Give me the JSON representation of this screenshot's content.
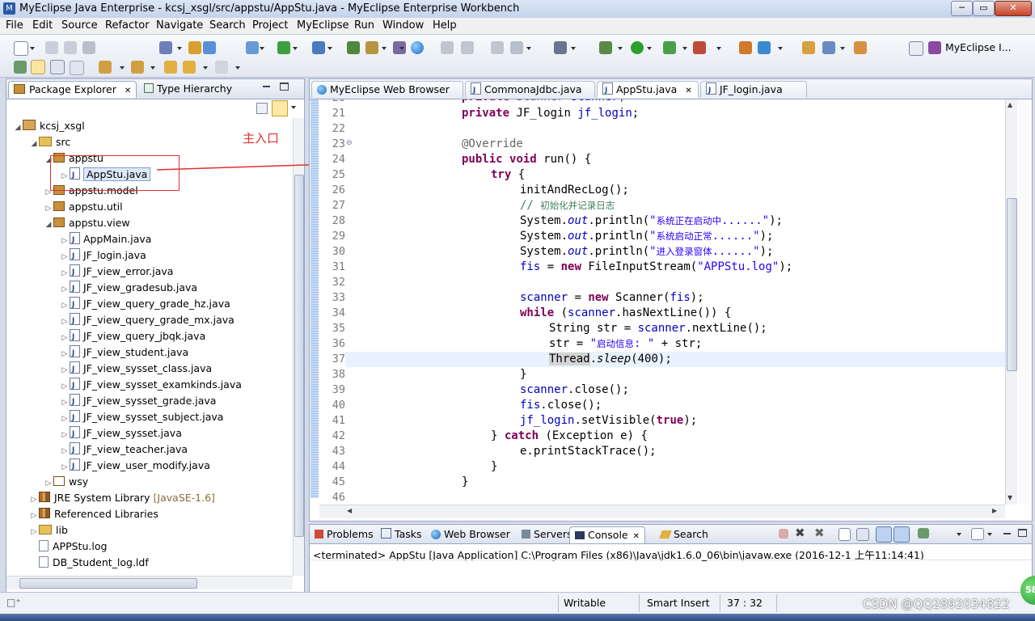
{
  "window": {
    "title": "MyEclipse Java Enterprise - kcsj_xsgl/src/appstu/AppStu.java - MyEclipse Enterprise Workbench",
    "minimize": "─",
    "maximize": "▭",
    "close": "✕"
  },
  "menu": [
    "File",
    "Edit",
    "Source",
    "Refactor",
    "Navigate",
    "Search",
    "Project",
    "MyEclipse",
    "Run",
    "Window",
    "Help"
  ],
  "perspective": {
    "label": "MyEclipse I..."
  },
  "package_explorer": {
    "tabs": [
      {
        "label": "Package Explorer",
        "close": "✕"
      },
      {
        "label": "Type Hierarchy"
      }
    ],
    "tree": [
      {
        "label": "kcsj_xsgl",
        "icon": "project",
        "depth": 0,
        "toggle": "expanded"
      },
      {
        "label": "src",
        "icon": "folder",
        "depth": 1,
        "toggle": "expanded"
      },
      {
        "label": "appstu",
        "icon": "package",
        "depth": 2,
        "toggle": "expanded"
      },
      {
        "label": "AppStu.java",
        "icon": "java",
        "depth": 3,
        "toggle": "collapsed",
        "selected": true
      },
      {
        "label": "appstu.model",
        "icon": "package",
        "depth": 2,
        "toggle": "collapsed"
      },
      {
        "label": "appstu.util",
        "icon": "package",
        "depth": 2,
        "toggle": "collapsed"
      },
      {
        "label": "appstu.view",
        "icon": "package",
        "depth": 2,
        "toggle": "expanded"
      },
      {
        "label": "AppMain.java",
        "icon": "java",
        "depth": 3,
        "toggle": "collapsed"
      },
      {
        "label": "JF_login.java",
        "icon": "java",
        "depth": 3,
        "toggle": "collapsed"
      },
      {
        "label": "JF_view_error.java",
        "icon": "java",
        "depth": 3,
        "toggle": "collapsed"
      },
      {
        "label": "JF_view_gradesub.java",
        "icon": "java",
        "depth": 3,
        "toggle": "collapsed"
      },
      {
        "label": "JF_view_query_grade_hz.java",
        "icon": "java",
        "depth": 3,
        "toggle": "collapsed"
      },
      {
        "label": "JF_view_query_grade_mx.java",
        "icon": "java",
        "depth": 3,
        "toggle": "collapsed"
      },
      {
        "label": "JF_view_query_jbqk.java",
        "icon": "java",
        "depth": 3,
        "toggle": "collapsed"
      },
      {
        "label": "JF_view_student.java",
        "icon": "java",
        "depth": 3,
        "toggle": "collapsed"
      },
      {
        "label": "JF_view_sysset_class.java",
        "icon": "java",
        "depth": 3,
        "toggle": "collapsed"
      },
      {
        "label": "JF_view_sysset_examkinds.java",
        "icon": "java",
        "depth": 3,
        "toggle": "collapsed"
      },
      {
        "label": "JF_view_sysset_grade.java",
        "icon": "java",
        "depth": 3,
        "toggle": "collapsed"
      },
      {
        "label": "JF_view_sysset_subject.java",
        "icon": "java",
        "depth": 3,
        "toggle": "collapsed"
      },
      {
        "label": "JF_view_sysset.java",
        "icon": "java",
        "depth": 3,
        "toggle": "collapsed"
      },
      {
        "label": "JF_view_teacher.java",
        "icon": "java",
        "depth": 3,
        "toggle": "collapsed"
      },
      {
        "label": "JF_view_user_modify.java",
        "icon": "java",
        "depth": 3,
        "toggle": "collapsed"
      },
      {
        "label": "wsy",
        "icon": "package-empty",
        "depth": 2,
        "toggle": "collapsed"
      },
      {
        "label": "JRE System Library",
        "suffix": "[JavaSE-1.6]",
        "icon": "library",
        "depth": 1,
        "toggle": "collapsed"
      },
      {
        "label": "Referenced Libraries",
        "icon": "library",
        "depth": 1,
        "toggle": "collapsed"
      },
      {
        "label": "lib",
        "icon": "folder",
        "depth": 1,
        "toggle": "collapsed"
      },
      {
        "label": "APPStu.log",
        "icon": "file",
        "depth": 1,
        "toggle": "none"
      },
      {
        "label": "DB_Student_log.ldf",
        "icon": "file",
        "depth": 1,
        "toggle": "none"
      }
    ]
  },
  "annotation": {
    "label": "主入口",
    "color": "#e03030"
  },
  "editor": {
    "tabs": [
      {
        "label": "MyEclipse Web Browser",
        "icon": "globe"
      },
      {
        "label": "CommonaJdbc.java",
        "icon": "java"
      },
      {
        "label": "AppStu.java",
        "icon": "java",
        "active": true,
        "close": "✕"
      },
      {
        "label": "JF_login.java",
        "icon": "java"
      }
    ],
    "partial_top_line": "20",
    "cursor_line": 37,
    "lines": [
      {
        "n": "21",
        "indent": 2,
        "segs": [
          [
            "kw",
            "private"
          ],
          [
            "t",
            " JF_login "
          ],
          [
            "fld",
            "jf_login"
          ],
          [
            "t",
            ";"
          ]
        ]
      },
      {
        "n": "22",
        "indent": 0,
        "segs": []
      },
      {
        "n": "23",
        "indent": 2,
        "fold": true,
        "segs": [
          [
            "ann",
            "@Override"
          ]
        ]
      },
      {
        "n": "24",
        "indent": 2,
        "segs": [
          [
            "kw",
            "public"
          ],
          [
            "t",
            " "
          ],
          [
            "kw",
            "void"
          ],
          [
            "t",
            " run() {"
          ]
        ]
      },
      {
        "n": "25",
        "indent": 3,
        "segs": [
          [
            "kw",
            "try"
          ],
          [
            "t",
            " {"
          ]
        ]
      },
      {
        "n": "26",
        "indent": 4,
        "segs": [
          [
            "t",
            "initAndRecLog();"
          ]
        ]
      },
      {
        "n": "27",
        "indent": 4,
        "segs": [
          [
            "cm",
            "// "
          ],
          [
            "cmcn",
            "初始化并记录日志"
          ]
        ]
      },
      {
        "n": "28",
        "indent": 4,
        "segs": [
          [
            "t",
            "System."
          ],
          [
            "fldi",
            "out"
          ],
          [
            "t",
            ".println("
          ],
          [
            "str",
            "\""
          ],
          [
            "strcn",
            "系统正在启动中"
          ],
          [
            "str",
            "......\""
          ],
          [
            "t",
            ");"
          ]
        ]
      },
      {
        "n": "29",
        "indent": 4,
        "segs": [
          [
            "t",
            "System."
          ],
          [
            "fldi",
            "out"
          ],
          [
            "t",
            ".println("
          ],
          [
            "str",
            "\""
          ],
          [
            "strcn",
            "系统启动正常"
          ],
          [
            "str",
            "......\""
          ],
          [
            "t",
            ");"
          ]
        ]
      },
      {
        "n": "30",
        "indent": 4,
        "segs": [
          [
            "t",
            "System."
          ],
          [
            "fldi",
            "out"
          ],
          [
            "t",
            ".println("
          ],
          [
            "str",
            "\""
          ],
          [
            "strcn",
            "进入登录窗体"
          ],
          [
            "str",
            "......\""
          ],
          [
            "t",
            ");"
          ]
        ]
      },
      {
        "n": "31",
        "indent": 4,
        "segs": [
          [
            "fld",
            "fis"
          ],
          [
            "t",
            " = "
          ],
          [
            "kw",
            "new"
          ],
          [
            "t",
            " FileInputStream("
          ],
          [
            "str",
            "\"APPStu.log\""
          ],
          [
            "t",
            ");"
          ]
        ]
      },
      {
        "n": "32",
        "indent": 0,
        "segs": []
      },
      {
        "n": "33",
        "indent": 4,
        "segs": [
          [
            "fld",
            "scanner"
          ],
          [
            "t",
            " = "
          ],
          [
            "kw",
            "new"
          ],
          [
            "t",
            " Scanner("
          ],
          [
            "fld",
            "fis"
          ],
          [
            "t",
            ");"
          ]
        ]
      },
      {
        "n": "34",
        "indent": 4,
        "segs": [
          [
            "kw",
            "while"
          ],
          [
            "t",
            " ("
          ],
          [
            "fld",
            "scanner"
          ],
          [
            "t",
            ".hasNextLine()) {"
          ]
        ]
      },
      {
        "n": "35",
        "indent": 5,
        "segs": [
          [
            "t",
            "String str = "
          ],
          [
            "fld",
            "scanner"
          ],
          [
            "t",
            ".nextLine();"
          ]
        ]
      },
      {
        "n": "36",
        "indent": 5,
        "segs": [
          [
            "t",
            "str = "
          ],
          [
            "str",
            "\""
          ],
          [
            "strcn",
            "启动信息"
          ],
          [
            "str",
            ": \""
          ],
          [
            "t",
            " + str;"
          ]
        ]
      },
      {
        "n": "37",
        "indent": 5,
        "segs": [
          [
            "hl",
            "Thread"
          ],
          [
            "t",
            "."
          ],
          [
            "itl",
            "sleep"
          ],
          [
            "t",
            "(400);"
          ]
        ]
      },
      {
        "n": "38",
        "indent": 4,
        "segs": [
          [
            "t",
            "}"
          ]
        ]
      },
      {
        "n": "39",
        "indent": 4,
        "segs": [
          [
            "fld",
            "scanner"
          ],
          [
            "t",
            ".close();"
          ]
        ]
      },
      {
        "n": "40",
        "indent": 4,
        "segs": [
          [
            "fld",
            "fis"
          ],
          [
            "t",
            ".close();"
          ]
        ]
      },
      {
        "n": "41",
        "indent": 4,
        "segs": [
          [
            "fld",
            "jf_login"
          ],
          [
            "t",
            ".setVisible("
          ],
          [
            "kw",
            "true"
          ],
          [
            "t",
            ");"
          ]
        ]
      },
      {
        "n": "42",
        "indent": 3,
        "segs": [
          [
            "t",
            "} "
          ],
          [
            "kw",
            "catch"
          ],
          [
            "t",
            " (Exception e) {"
          ]
        ]
      },
      {
        "n": "43",
        "indent": 4,
        "segs": [
          [
            "t",
            "e.printStackTrace();"
          ]
        ]
      },
      {
        "n": "44",
        "indent": 3,
        "segs": [
          [
            "t",
            "}"
          ]
        ]
      },
      {
        "n": "45",
        "indent": 2,
        "segs": [
          [
            "t",
            "}"
          ]
        ]
      },
      {
        "n": "46",
        "indent": 0,
        "segs": []
      }
    ]
  },
  "bottom_panel": {
    "tabs": [
      {
        "label": "Problems"
      },
      {
        "label": "Tasks"
      },
      {
        "label": "Web Browser"
      },
      {
        "label": "Servers"
      },
      {
        "label": "Console",
        "active": true,
        "close": "✕"
      },
      {
        "label": "Search"
      }
    ],
    "console_text": "<terminated> AppStu [Java Application] C:\\Program Files (x86)\\Java\\jdk1.6.0_06\\bin\\javaw.exe (2016-12-1 上午11:14:41)"
  },
  "statusbar": {
    "mode": "Writable",
    "insert": "Smart Insert",
    "position": "37 : 32"
  },
  "watermark": "CSDN @QQ2892034822",
  "badge": "58",
  "colors": {
    "keyword": "#7f0055",
    "field": "#0000c0",
    "string": "#2a00ff",
    "comment": "#3f7f5f",
    "annotation_red": "#e03030"
  }
}
